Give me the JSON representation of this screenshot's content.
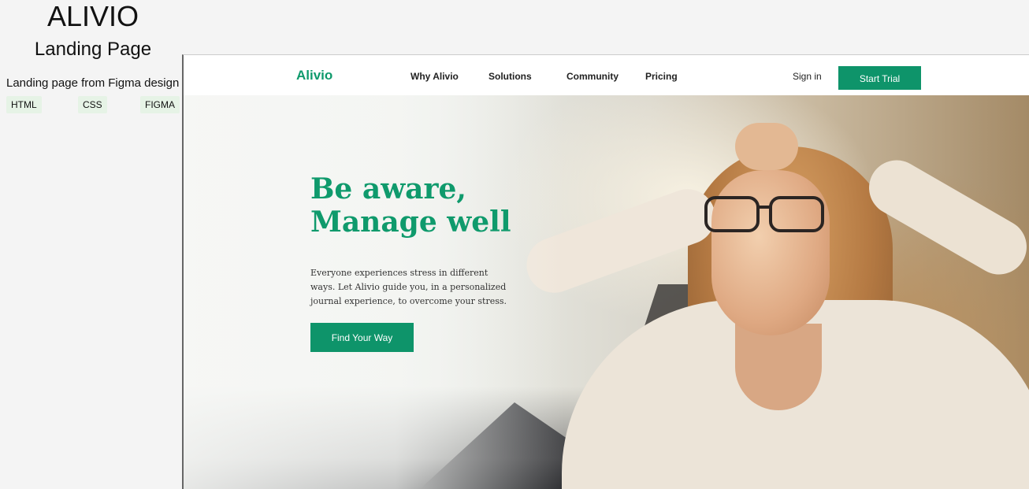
{
  "side": {
    "title": "ALIVIO",
    "subtitle": "Landing Page",
    "description": "Landing page from Figma design",
    "tags": [
      "HTML",
      "CSS",
      "FIGMA"
    ]
  },
  "site": {
    "logo": "Alivio",
    "nav": [
      "Why Alivio",
      "Solutions",
      "Community",
      "Pricing"
    ],
    "sign_in": "Sign in",
    "start_trial": "Start Trial",
    "headline": [
      "Be aware,",
      "Manage well"
    ],
    "body": "Everyone experiences stress in different ways. Let Alivio guide you, in a personalized journal experience, to overcome your stress.",
    "cta": "Find Your Way"
  },
  "colors": {
    "brand_green": "#0f9a6c",
    "button_green": "#0e946a",
    "tag_bg": "#e6f3e6"
  }
}
